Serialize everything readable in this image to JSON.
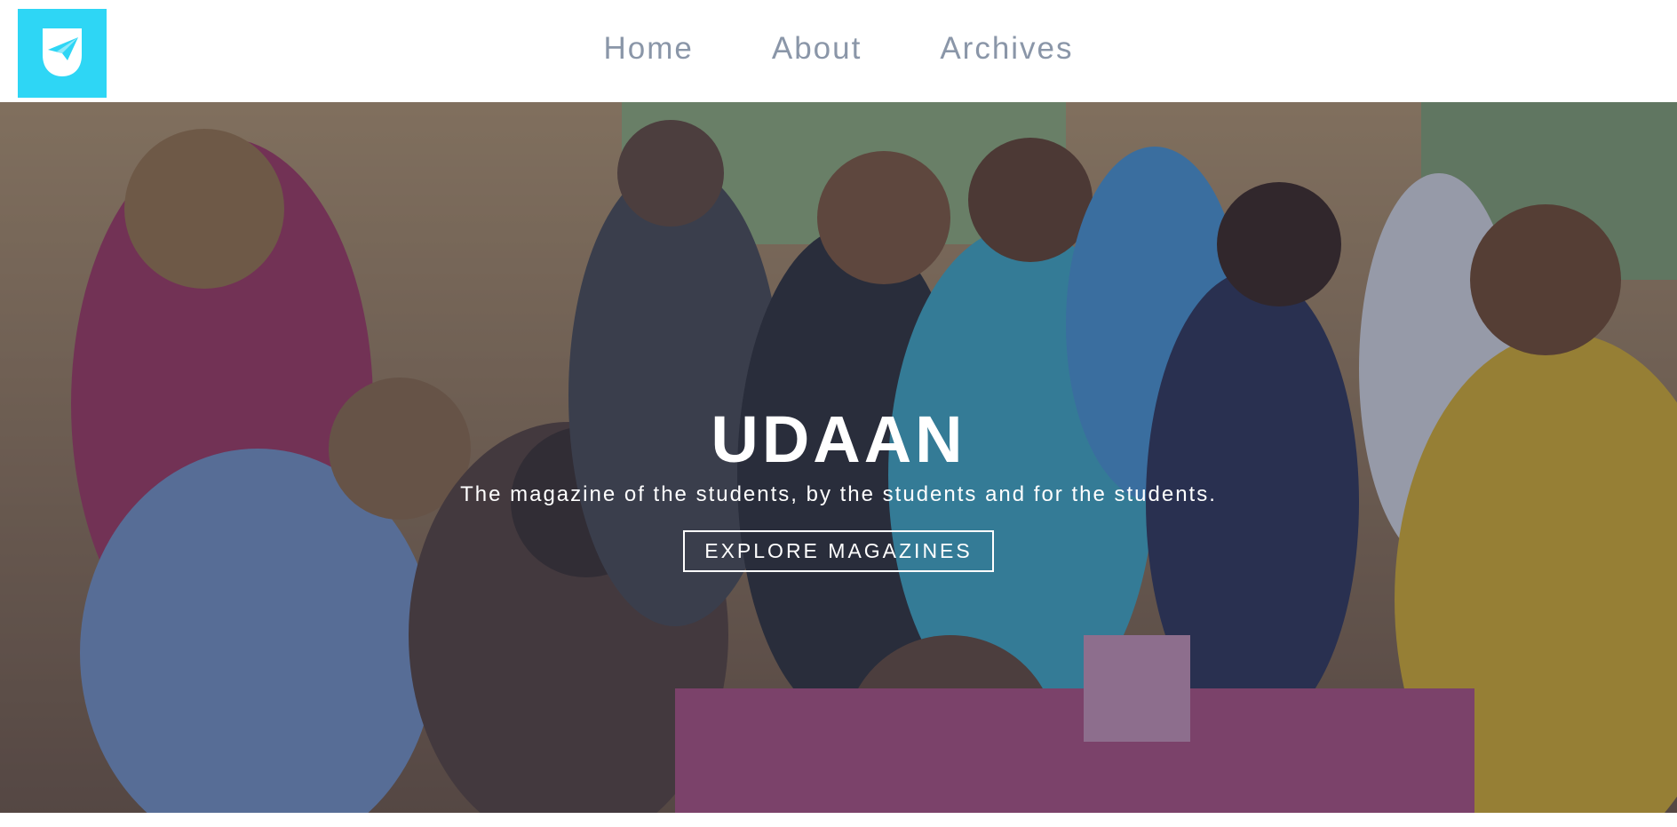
{
  "header": {
    "logo_icon": "paper-plane-logo-icon",
    "accent_color": "#2ed6f5",
    "nav": [
      {
        "label": "Home"
      },
      {
        "label": "About"
      },
      {
        "label": "Archives"
      }
    ]
  },
  "hero": {
    "title": "UDAAN",
    "subtitle": "The magazine of the students, by the students and for the students.",
    "cta_label": "EXPLORE MAGAZINES",
    "background": "crowd-of-students-photo"
  }
}
